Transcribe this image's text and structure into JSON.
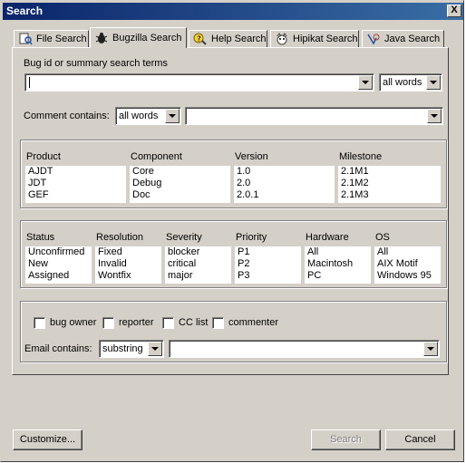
{
  "window": {
    "title": "Search",
    "close_label": "X"
  },
  "tabs": [
    {
      "label": "File Search",
      "icon": "file-search-icon",
      "active": false
    },
    {
      "label": "Bugzilla Search",
      "icon": "bug-icon",
      "active": true
    },
    {
      "label": "Help Search",
      "icon": "help-search-icon",
      "active": false
    },
    {
      "label": "Hipikat Search",
      "icon": "hipikat-icon",
      "active": false
    },
    {
      "label": "Java Search",
      "icon": "java-search-icon",
      "active": false
    }
  ],
  "search_terms": {
    "label": "Bug id or summary search terms",
    "value": "",
    "mode": "all words"
  },
  "comment": {
    "label": "Comment contains:",
    "mode": "all words",
    "value": ""
  },
  "group1": {
    "columns": [
      {
        "header": "Product",
        "items": [
          "AJDT",
          "JDT",
          "GEF"
        ]
      },
      {
        "header": "Component",
        "items": [
          "Core",
          "Debug",
          "Doc"
        ]
      },
      {
        "header": "Version",
        "items": [
          "1.0",
          "2.0",
          "2.0.1"
        ]
      },
      {
        "header": "Milestone",
        "items": [
          "2.1M1",
          "2.1M2",
          "2.1M3"
        ]
      }
    ]
  },
  "group2": {
    "columns": [
      {
        "header": "Status",
        "items": [
          "Unconfirmed",
          "New",
          "Assigned"
        ]
      },
      {
        "header": "Resolution",
        "items": [
          "Fixed",
          "Invalid",
          "Wontfix"
        ]
      },
      {
        "header": "Severity",
        "items": [
          "blocker",
          "critical",
          "major"
        ]
      },
      {
        "header": "Priority",
        "items": [
          "P1",
          "P2",
          "P3"
        ]
      },
      {
        "header": "Hardware",
        "items": [
          "All",
          "Macintosh",
          "PC"
        ]
      },
      {
        "header": "OS",
        "items": [
          "All",
          "AIX Motif",
          "Windows 95"
        ]
      }
    ]
  },
  "email": {
    "checkboxes": [
      "bug owner",
      "reporter",
      "CC list",
      "commenter"
    ],
    "label": "Email contains:",
    "mode": "substring",
    "value": ""
  },
  "buttons": {
    "customize": "Customize...",
    "search": "Search",
    "cancel": "Cancel"
  },
  "colors": {
    "titlebar_start": "#0a246a",
    "titlebar_end": "#3a6ea5",
    "face": "#d4d0c8"
  }
}
